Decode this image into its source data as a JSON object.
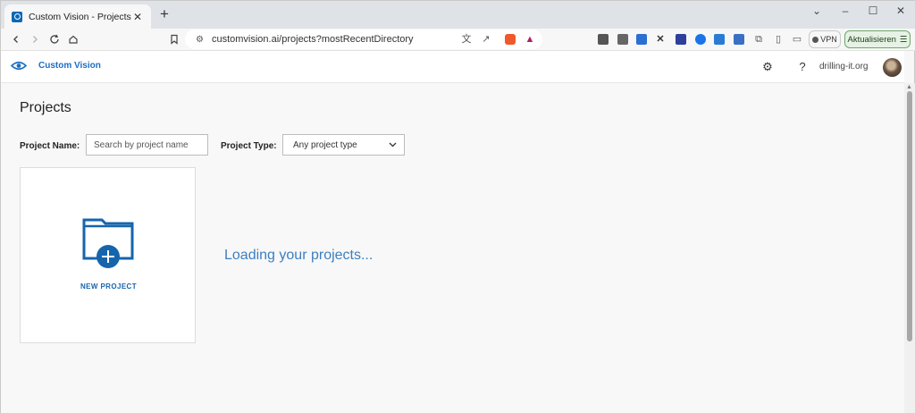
{
  "browser": {
    "tab_title": "Custom Vision - Projects",
    "tab_close": "✕",
    "new_tab": "+",
    "url": "customvision.ai/projects?mostRecentDirectory",
    "vpn_label": "VPN",
    "update_label": "Aktualisieren"
  },
  "app": {
    "name": "Custom Vision",
    "account": "drilling-it.org"
  },
  "page": {
    "title": "Projects",
    "project_name_label": "Project Name:",
    "search_placeholder": "Search by project name",
    "project_type_label": "Project Type:",
    "project_type_value": "Any project type",
    "new_project_label": "NEW PROJECT",
    "loading_text": "Loading your projects..."
  },
  "colors": {
    "accent": "#0a68b5",
    "link": "#1b6ec2"
  }
}
